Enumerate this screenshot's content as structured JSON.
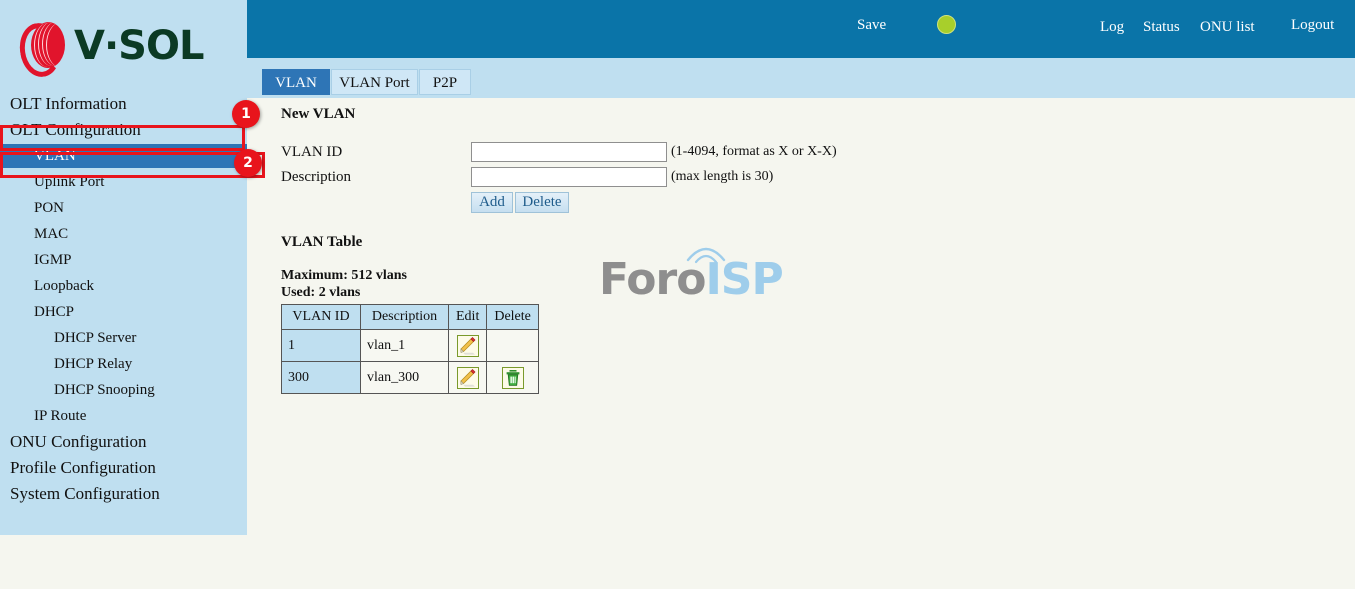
{
  "brand": {
    "logo_text": "V·SOL",
    "logo_icon": "vsol-swirl-icon",
    "logo_red": "#e1142c",
    "logo_green": "#0b3a24"
  },
  "header": {
    "bg_color": "#0a74a8",
    "save_label": "Save",
    "status_indicator": {
      "name": "status-indicator-dot",
      "color": "#a8cf2b"
    },
    "links": [
      {
        "label": "Log",
        "name": "log-link"
      },
      {
        "label": "Status",
        "name": "status-link"
      },
      {
        "label": "ONU list",
        "name": "onu-list-link"
      },
      {
        "label": "Logout",
        "name": "logout-link"
      }
    ]
  },
  "sidebar": {
    "bg_color": "#bfdff0",
    "active_color": "#2e75b6",
    "items": [
      {
        "label": "OLT Information",
        "level": 1,
        "active": false
      },
      {
        "label": "OLT Configuration",
        "level": 1,
        "active": false
      },
      {
        "label": "VLAN",
        "level": 2,
        "active": true
      },
      {
        "label": "Uplink Port",
        "level": 2,
        "active": false
      },
      {
        "label": "PON",
        "level": 2,
        "active": false
      },
      {
        "label": "MAC",
        "level": 2,
        "active": false
      },
      {
        "label": "IGMP",
        "level": 2,
        "active": false
      },
      {
        "label": "Loopback",
        "level": 2,
        "active": false
      },
      {
        "label": "DHCP",
        "level": 2,
        "active": false
      },
      {
        "label": "DHCP Server",
        "level": 3,
        "active": false
      },
      {
        "label": "DHCP Relay",
        "level": 3,
        "active": false
      },
      {
        "label": "DHCP Snooping",
        "level": 3,
        "active": false
      },
      {
        "label": "IP Route",
        "level": 2,
        "active": false
      },
      {
        "label": "ONU Configuration",
        "level": 1,
        "active": false
      },
      {
        "label": "Profile Configuration",
        "level": 1,
        "active": false
      },
      {
        "label": "System Configuration",
        "level": 1,
        "active": false
      }
    ]
  },
  "tabs": [
    {
      "label": "VLAN",
      "active": true
    },
    {
      "label": "VLAN Port",
      "active": false
    },
    {
      "label": "P2P",
      "active": false
    }
  ],
  "new_vlan": {
    "title": "New VLAN",
    "vlan_id_label": "VLAN ID",
    "vlan_id_value": "",
    "vlan_id_hint": "(1-4094, format as X or X-X)",
    "description_label": "Description",
    "description_value": "",
    "description_hint": "(max length is 30)",
    "add_label": "Add",
    "delete_label": "Delete"
  },
  "vlan_table": {
    "title": "VLAN Table",
    "maximum_text": "Maximum: 512 vlans",
    "used_text": "Used: 2 vlans",
    "columns": [
      "VLAN ID",
      "Description",
      "Edit",
      "Delete"
    ],
    "rows": [
      {
        "id": "1",
        "description": "vlan_1",
        "edit_icon": "edit-pencil-icon",
        "delete_icon": ""
      },
      {
        "id": "300",
        "description": "vlan_300",
        "edit_icon": "edit-pencil-icon",
        "delete_icon": "trash-can-icon"
      }
    ]
  },
  "watermark": {
    "part1": "Foro",
    "part2": "ISP",
    "color1": "#8e8e8e",
    "color2": "#9ecdeb"
  },
  "annotations": [
    {
      "number": "1",
      "target": "OLT Configuration",
      "color": "#e8141c"
    },
    {
      "number": "2",
      "target": "VLAN",
      "color": "#e8141c"
    }
  ]
}
